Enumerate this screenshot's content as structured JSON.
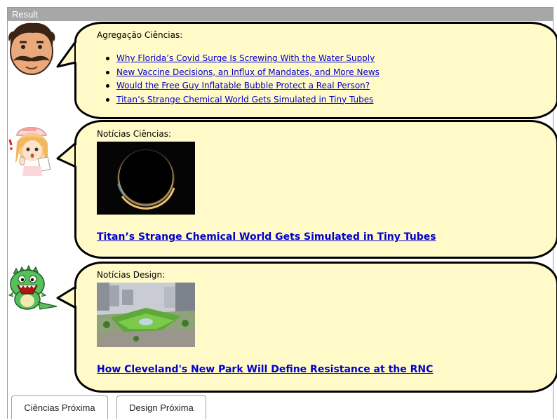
{
  "window": {
    "title": "Result"
  },
  "aggregation": {
    "title": "Agregação Ciências:",
    "items": [
      "Why Florida’s Covid Surge Is Screwing With the Water Supply",
      "New Vaccine Decisions, an Influx of Mandates, and More News",
      "Would the Free Guy Inflatable Bubble Protect a Real Person?",
      "Titan’s Strange Chemical World Gets Simulated in Tiny Tubes"
    ]
  },
  "science_news": {
    "title": "Notícias Ciências:",
    "headline": "Titan’s Strange Chemical World Gets Simulated in Tiny Tubes",
    "image_icon": "titan-eclipse-image"
  },
  "design_news": {
    "title": "Notícias Design:",
    "headline": "How Cleveland's New Park Will Define Resistance at the RNC",
    "image_icon": "park-aerial-image"
  },
  "buttons": {
    "science_next": "Ciências Próxima",
    "design_next": "Design Próxima"
  },
  "colors": {
    "bubble_fill": "#fffac8",
    "link": "#0000cc",
    "titlebar": "#a7a7a7"
  }
}
